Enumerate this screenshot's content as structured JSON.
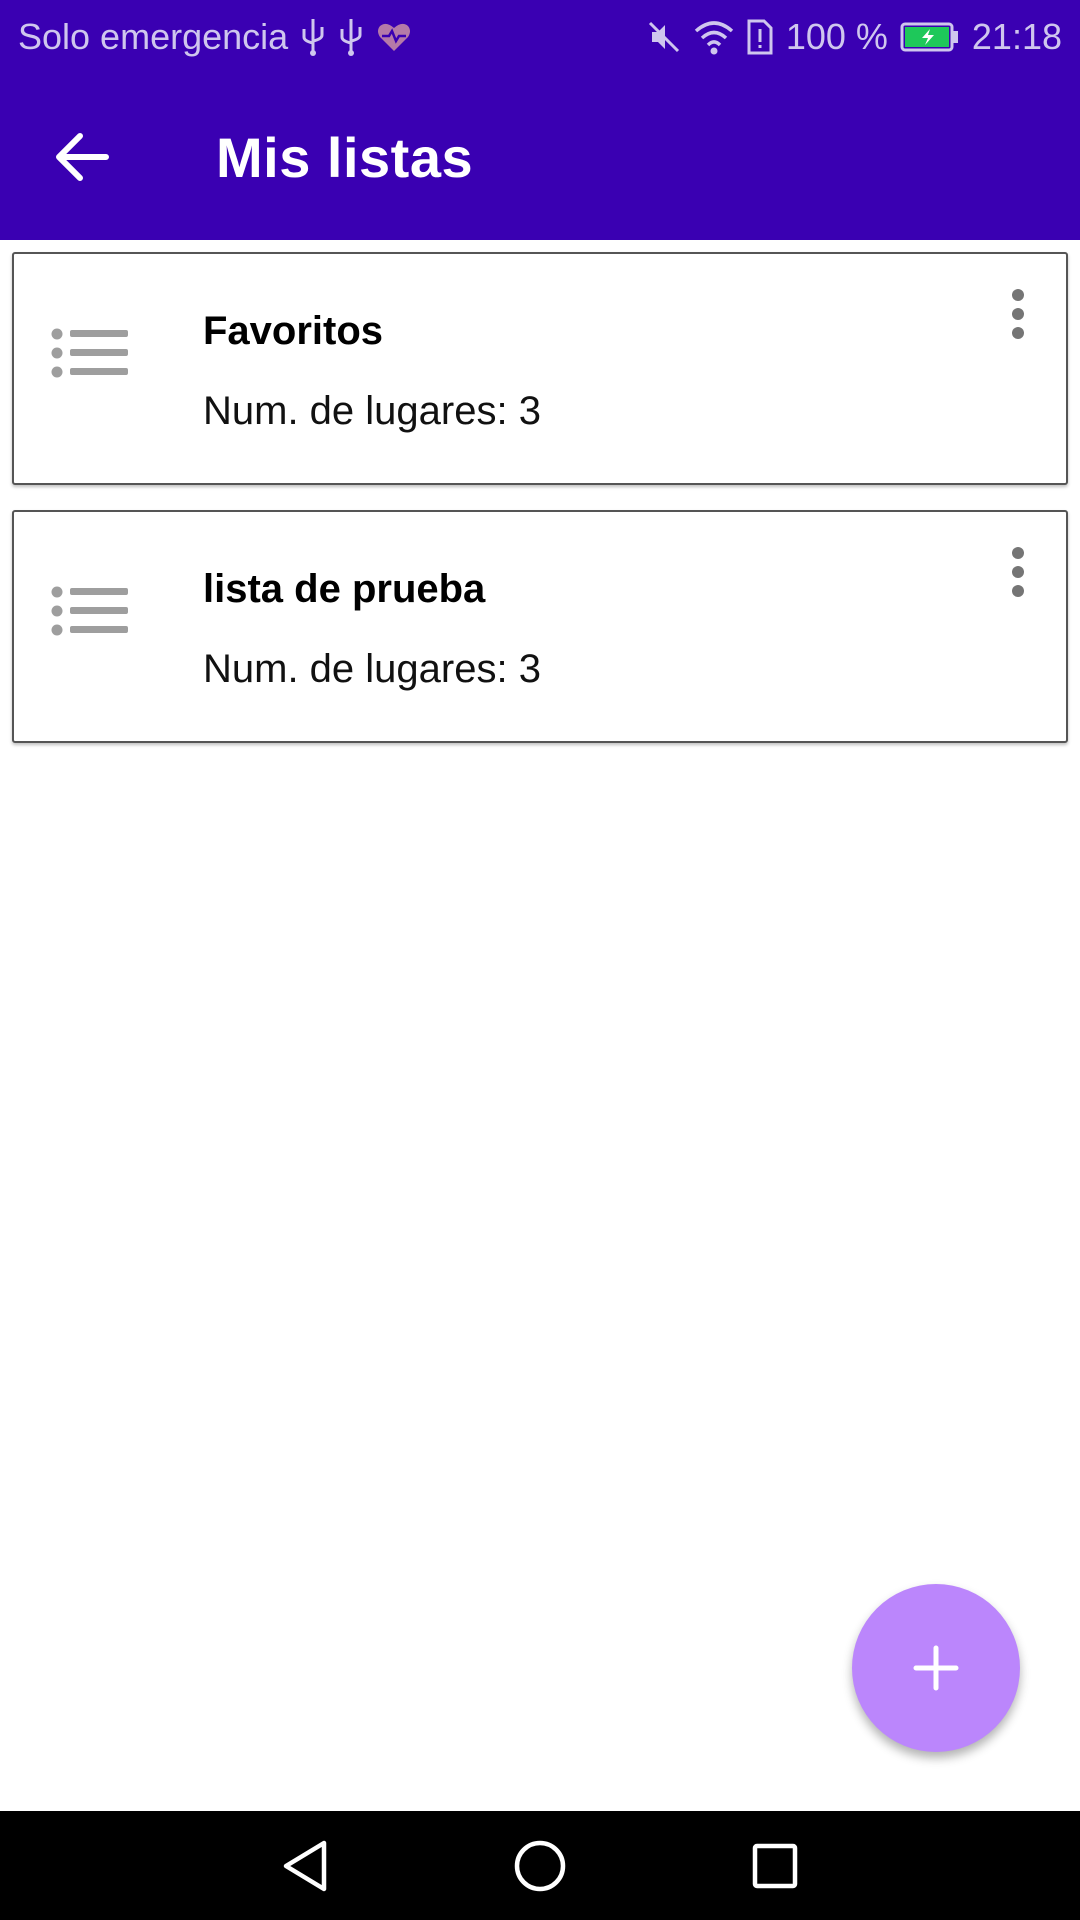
{
  "status_bar": {
    "carrier": "Solo emergencia",
    "battery": "100 %",
    "time": "21:18",
    "icons_left": [
      "usb-icon",
      "usb-icon",
      "health-icon"
    ],
    "icons_right": [
      "mute-icon",
      "wifi-icon",
      "sim-alert-icon",
      "battery-charging-icon"
    ]
  },
  "app_bar": {
    "title": "Mis listas",
    "back_icon": "arrow-back-icon"
  },
  "lists": [
    {
      "name": "Favoritos",
      "count_label": "Num. de lugares: 3"
    },
    {
      "name": "lista de prueba",
      "count_label": "Num. de lugares: 3"
    }
  ],
  "fab": {
    "icon": "plus-icon"
  },
  "nav_bar": {
    "buttons": [
      "back-triangle-icon",
      "home-circle-icon",
      "recents-square-icon"
    ]
  },
  "colors": {
    "primary": "#3a00b2",
    "fab": "#bb86fc",
    "list_icon": "#9e9e9e",
    "menu_dots": "#757575"
  }
}
